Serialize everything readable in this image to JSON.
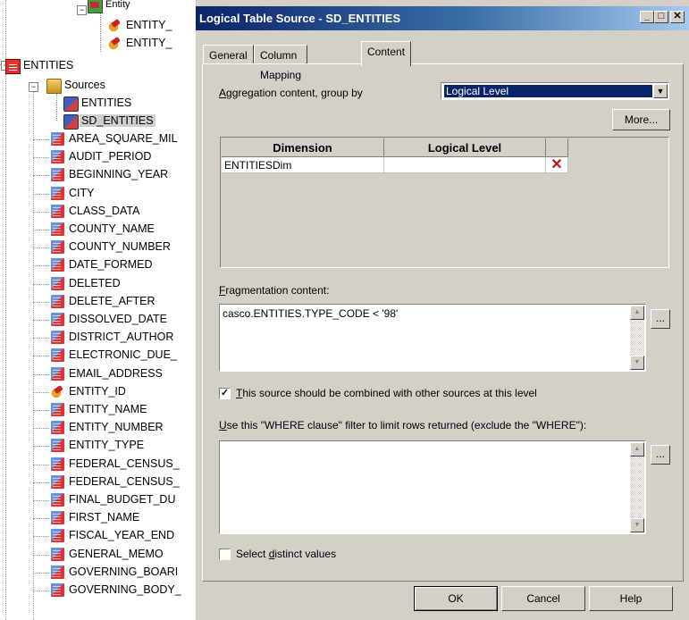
{
  "tree": {
    "top_items": [
      {
        "label": "Entity",
        "icon": "entity-icon"
      },
      {
        "label": "ENTITY_",
        "icon": "key-icon"
      },
      {
        "label": "ENTITY_",
        "icon": "key-icon"
      }
    ],
    "root": {
      "label": "ENTITIES",
      "icon": "logical-table-icon",
      "expander": "−"
    },
    "sources": {
      "label": "Sources",
      "icon": "folder-icon",
      "expander": "−"
    },
    "source_items": [
      {
        "label": "ENTITIES",
        "icon": "table-source-icon"
      },
      {
        "label": "SD_ENTITIES",
        "icon": "table-source-icon",
        "selected": true
      }
    ],
    "columns": [
      {
        "label": "AREA_SQUARE_MIL",
        "icon": "column-icon"
      },
      {
        "label": "AUDIT_PERIOD",
        "icon": "column-icon"
      },
      {
        "label": "BEGINNING_YEAR",
        "icon": "column-icon"
      },
      {
        "label": "CITY",
        "icon": "column-icon"
      },
      {
        "label": "CLASS_DATA",
        "icon": "column-icon"
      },
      {
        "label": "COUNTY_NAME",
        "icon": "column-icon"
      },
      {
        "label": "COUNTY_NUMBER",
        "icon": "column-icon"
      },
      {
        "label": "DATE_FORMED",
        "icon": "column-icon"
      },
      {
        "label": "DELETED",
        "icon": "column-icon"
      },
      {
        "label": "DELETE_AFTER",
        "icon": "column-icon"
      },
      {
        "label": "DISSOLVED_DATE",
        "icon": "column-icon"
      },
      {
        "label": "DISTRICT_AUTHOR",
        "icon": "column-icon"
      },
      {
        "label": "ELECTRONIC_DUE_",
        "icon": "column-icon"
      },
      {
        "label": "EMAIL_ADDRESS",
        "icon": "column-icon"
      },
      {
        "label": "ENTITY_ID",
        "icon": "key-icon"
      },
      {
        "label": "ENTITY_NAME",
        "icon": "column-icon"
      },
      {
        "label": "ENTITY_NUMBER",
        "icon": "column-icon"
      },
      {
        "label": "ENTITY_TYPE",
        "icon": "column-icon"
      },
      {
        "label": "FEDERAL_CENSUS_",
        "icon": "column-icon"
      },
      {
        "label": "FEDERAL_CENSUS_",
        "icon": "column-icon"
      },
      {
        "label": "FINAL_BUDGET_DU",
        "icon": "column-icon"
      },
      {
        "label": "FIRST_NAME",
        "icon": "column-icon"
      },
      {
        "label": "FISCAL_YEAR_END",
        "icon": "column-icon"
      },
      {
        "label": "GENERAL_MEMO",
        "icon": "column-icon"
      },
      {
        "label": "GOVERNING_BOARI",
        "icon": "column-icon"
      },
      {
        "label": "GOVERNING_BODY_",
        "icon": "column-icon"
      }
    ]
  },
  "dialog": {
    "title": "Logical Table Source - SD_ENTITIES",
    "title_buttons": {
      "minimize": "_",
      "maximize": "□",
      "close": "✕"
    },
    "tabs": [
      {
        "label": "General",
        "active": false
      },
      {
        "label": "Column Mapping",
        "active": false
      },
      {
        "label": "Content",
        "active": true
      }
    ],
    "aggregation": {
      "label_underline": "A",
      "label_rest": "ggregation content, group by",
      "selected": "Logical Level",
      "more_button": "More..."
    },
    "grid": {
      "columns": [
        "Dimension",
        "Logical Level"
      ],
      "rows": [
        {
          "dimension": "ENTITIESDim",
          "logical_level": ""
        }
      ],
      "delete_icon": "✕"
    },
    "fragmentation": {
      "label_underline": "F",
      "label_rest": "ragmentation content:",
      "value": "casco.ENTITIES.TYPE_CODE < '98'",
      "ellipsis_button": "..."
    },
    "combine_checkbox": {
      "checked": true,
      "check_glyph": "✓",
      "label_underline": "T",
      "label_rest": "his source should be combined with other sources at this level"
    },
    "where": {
      "label_underline": "U",
      "label_rest": "se this \"WHERE clause\" filter to limit rows returned (exclude the \"WHERE\"):",
      "value": "",
      "ellipsis_button": "..."
    },
    "distinct_checkbox": {
      "checked": false,
      "label_pre": "Select ",
      "label_underline": "d",
      "label_rest": "istinct values"
    },
    "buttons": {
      "ok": "OK",
      "cancel": "Cancel",
      "help": "Help"
    },
    "scroll_up": "▲",
    "scroll_down": "▼",
    "dropdown_arrow": "▼"
  },
  "colors": {
    "title_gradient_start": "#0a246a",
    "title_gradient_end": "#a6caf0",
    "dialog_face": "#d4d0c8",
    "selection": "#0a246a",
    "delete_icon": "#c01010"
  }
}
